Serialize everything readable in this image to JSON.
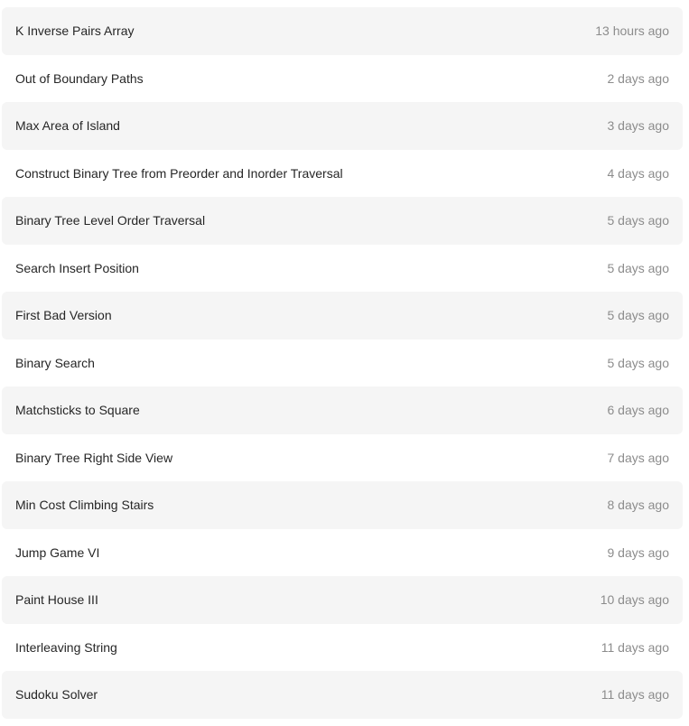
{
  "colors": {
    "shaded_row_bg": "#f5f5f5",
    "title_text": "#262626",
    "time_text": "#8c8c8c"
  },
  "submissions": [
    {
      "title": "K Inverse Pairs Array",
      "time": "13 hours ago"
    },
    {
      "title": "Out of Boundary Paths",
      "time": "2 days ago"
    },
    {
      "title": "Max Area of Island",
      "time": "3 days ago"
    },
    {
      "title": "Construct Binary Tree from Preorder and Inorder Traversal",
      "time": "4 days ago"
    },
    {
      "title": "Binary Tree Level Order Traversal",
      "time": "5 days ago"
    },
    {
      "title": "Search Insert Position",
      "time": "5 days ago"
    },
    {
      "title": "First Bad Version",
      "time": "5 days ago"
    },
    {
      "title": "Binary Search",
      "time": "5 days ago"
    },
    {
      "title": "Matchsticks to Square",
      "time": "6 days ago"
    },
    {
      "title": "Binary Tree Right Side View",
      "time": "7 days ago"
    },
    {
      "title": "Min Cost Climbing Stairs",
      "time": "8 days ago"
    },
    {
      "title": "Jump Game VI",
      "time": "9 days ago"
    },
    {
      "title": "Paint House III",
      "time": "10 days ago"
    },
    {
      "title": "Interleaving String",
      "time": "11 days ago"
    },
    {
      "title": "Sudoku Solver",
      "time": "11 days ago"
    }
  ]
}
